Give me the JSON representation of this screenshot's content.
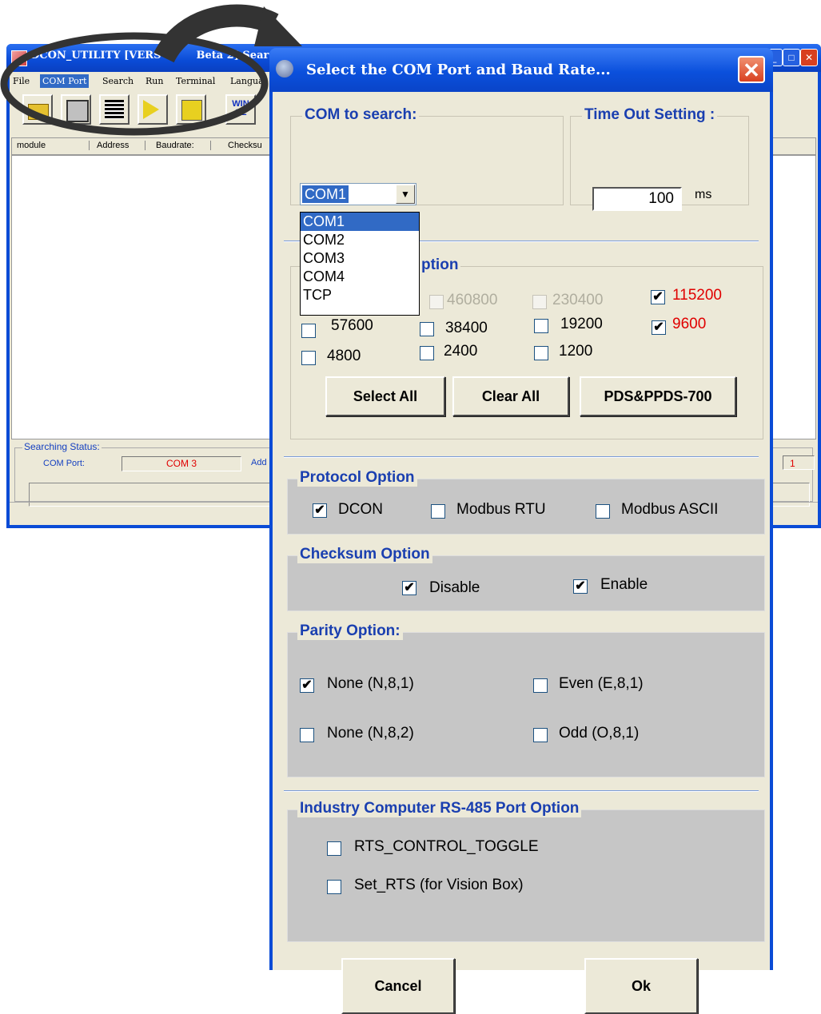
{
  "main_window": {
    "title": "DCON_UTILITY [VERS",
    "title_tail": "Beta 2] Sear",
    "menu": [
      "File",
      "COM Port",
      "Search",
      "Run",
      "Terminal",
      "Langua"
    ],
    "toolbar_icons": [
      "open-folder-icon",
      "save-disk-icon",
      "print-icon",
      "play-icon",
      "pause-icon",
      "wince-icon"
    ],
    "wince_label": "WIN CE",
    "columns": [
      "module",
      "Address",
      "Baudrate:",
      "Checksu"
    ],
    "searching_status_label": "Searching Status:",
    "com_port_label": "COM Port:",
    "com_port_value": "COM 3",
    "address_label": "Add",
    "right_value": "1"
  },
  "dialog": {
    "title": "Select the COM Port and Baud Rate...",
    "com_to_search": {
      "legend": "COM to search:",
      "selected": "COM1",
      "options": [
        "COM1",
        "COM2",
        "COM3",
        "COM4",
        "TCP"
      ]
    },
    "timeout": {
      "legend": "Time Out Setting :",
      "value": "100",
      "unit": "ms"
    },
    "baud": {
      "legend_visible": "ption",
      "rates": [
        {
          "label": "460800",
          "checked": false,
          "disabled": true
        },
        {
          "label": "230400",
          "checked": false,
          "disabled": true
        },
        {
          "label": "115200",
          "checked": true,
          "red": true
        },
        {
          "label": "57600",
          "checked": false
        },
        {
          "label": "38400",
          "checked": false
        },
        {
          "label": "19200",
          "checked": false
        },
        {
          "label": "9600",
          "checked": true,
          "red": true
        },
        {
          "label": "4800",
          "checked": false
        },
        {
          "label": "2400",
          "checked": false
        },
        {
          "label": "1200",
          "checked": false
        }
      ],
      "buttons": [
        "Select All",
        "Clear All",
        "PDS&PPDS-700"
      ]
    },
    "protocol": {
      "legend": "Protocol Option",
      "items": [
        {
          "label": "DCON",
          "checked": true
        },
        {
          "label": "Modbus RTU",
          "checked": false
        },
        {
          "label": "Modbus ASCII",
          "checked": false
        }
      ]
    },
    "checksum": {
      "legend": "Checksum  Option",
      "items": [
        {
          "label": "Disable",
          "checked": true
        },
        {
          "label": "Enable",
          "checked": true
        }
      ]
    },
    "parity": {
      "legend": "Parity Option:",
      "items": [
        {
          "label": "None  (N,8,1)",
          "checked": true
        },
        {
          "label": "Even  (E,8,1)",
          "checked": false
        },
        {
          "label": "None (N,8,2)",
          "checked": false
        },
        {
          "label": "Odd  (O,8,1)",
          "checked": false
        }
      ]
    },
    "rs485": {
      "legend": "Industry Computer RS-485 Port Option",
      "items": [
        {
          "label": "RTS_CONTROL_TOGGLE",
          "checked": false
        },
        {
          "label": "Set_RTS (for Vision Box)",
          "checked": false
        }
      ]
    },
    "cancel_label": "Cancel",
    "ok_label": "Ok",
    "check_mark": "✔"
  }
}
